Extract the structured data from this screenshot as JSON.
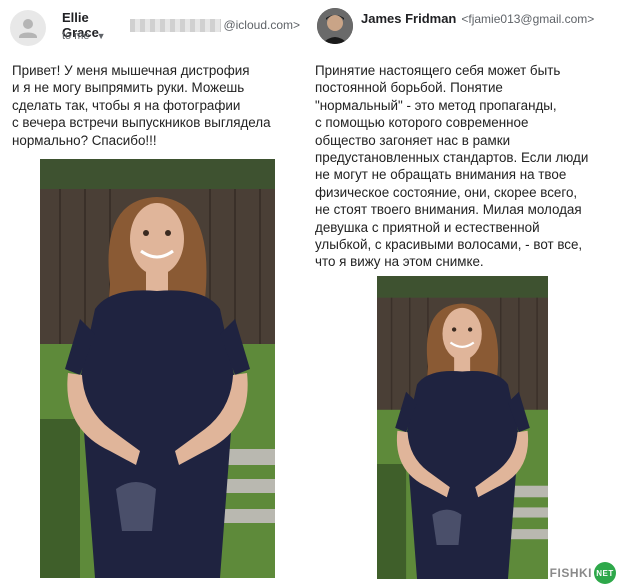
{
  "left": {
    "sender_name": "Ellie Grace",
    "sender_domain": "@icloud.com>",
    "recipient_label": "to me",
    "message": "Привет! У меня мышечная дистрофия\nи я не могу выпрямить руки. Можешь\nсделать так, чтобы я на фотографии\nс вечера встречи выпускников выглядела\nнормально? Спасибо!!!"
  },
  "right": {
    "sender_name": "James Fridman",
    "sender_email": "<fjamie013@gmail.com>",
    "message": "Принятие настоящего себя может быть\nпостоянной борьбой. Понятие\n\"нормальный\" - это метод пропаганды,\nс помощью которого современное\nобщество загоняет нас в рамки\nпредустановленных стандартов. Если люди\nне могут не обращать внимания на твое\nфизическое состояние, они, скорее всего,\nне стоят твоего внимания. Милая молодая\nдевушка с приятной и естественной\nулыбкой, с красивыми волосами, - вот все,\nчто я вижу на этом снимке."
  },
  "watermark": {
    "text": "FISHKI",
    "badge": "NET"
  },
  "colors": {
    "dress": "#1f2340",
    "hair": "#8a5a34",
    "skin": "#e0b59a",
    "grass": "#5e8a3a",
    "fence": "#4a3f36"
  }
}
